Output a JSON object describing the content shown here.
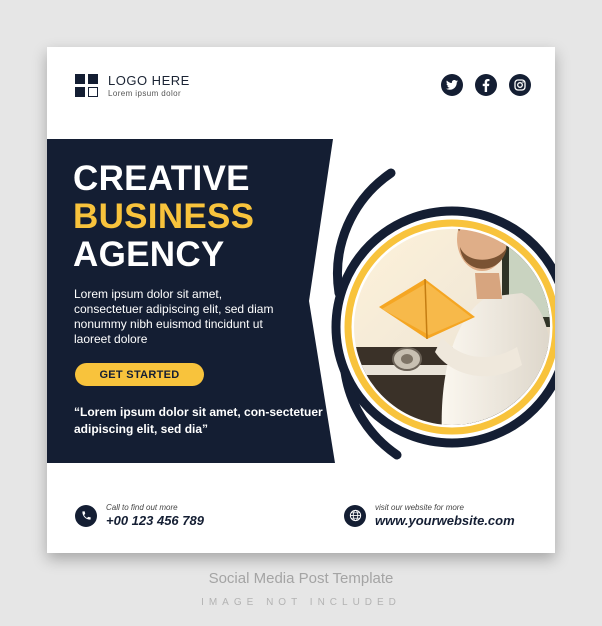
{
  "logo": {
    "title": "LOGO HERE",
    "subtitle": "Lorem ipsum dolor"
  },
  "social": [
    "twitter-icon",
    "facebook-icon",
    "instagram-icon"
  ],
  "headline": {
    "line1": "CREATIVE",
    "line2": "BUSINESS",
    "line3": "AGENCY"
  },
  "description": "Lorem ipsum dolor sit amet, consectetuer adipiscing elit, sed diam nonummy nibh euismod tincidunt ut laoreet dolore",
  "cta": "GET STARTED",
  "quote": "“Lorem ipsum dolor sit amet, con-sectetuer adipiscing elit, sed dia”",
  "phone": {
    "label": "Call to find out more",
    "value": "+00 123 456 789"
  },
  "website": {
    "label": "visit our website for more",
    "value": "www.yourwebsite.com"
  },
  "caption": {
    "title": "Social Media Post Template",
    "subtitle": "IMAGE NOT INCLUDED"
  },
  "colors": {
    "navy": "#141e33",
    "accent": "#f8c33c",
    "white": "#ffffff",
    "background": "#e6e6e6"
  }
}
